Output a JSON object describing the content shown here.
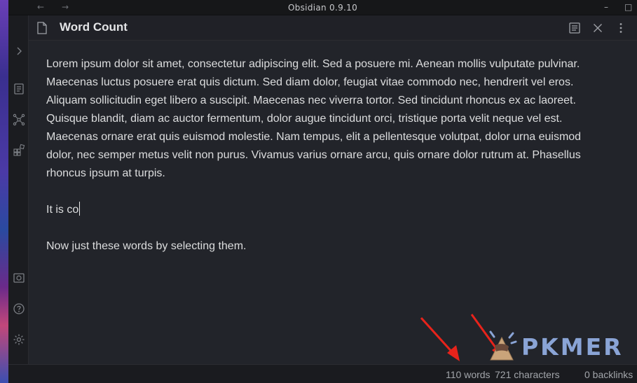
{
  "window": {
    "title": "Obsidian 0.9.10",
    "back_glyph": "←",
    "forward_glyph": "→",
    "minimize_glyph": "–",
    "maximize_glyph": "□"
  },
  "ribbon": {
    "icons": [
      "expand-chevron-icon",
      "switcher-icon",
      "graph-icon",
      "plugins-icon",
      "vault-icon",
      "help-icon",
      "settings-icon"
    ]
  },
  "pane": {
    "title": "Word Count",
    "actions": [
      "reading-view-icon",
      "close-icon",
      "more-options-icon"
    ]
  },
  "editor": {
    "paragraphs": [
      "Lorem ipsum dolor sit amet, consectetur adipiscing elit. Sed a posuere mi. Aenean mollis vulputate pulvinar. Maecenas luctus posuere erat quis dictum. Sed diam dolor, feugiat vitae commodo nec, hendrerit vel eros. Aliquam sollicitudin eget libero a suscipit. Maecenas nec viverra tortor. Sed tincidunt rhoncus ex ac laoreet. Quisque blandit, diam ac auctor fermentum, dolor augue tincidunt orci, tristique porta velit neque vel est. Maecenas ornare erat quis euismod molestie. Nam tempus, elit a pellentesque volutpat, dolor urna euismod dolor, nec semper metus velit non purus. Vivamus varius ornare arcu, quis ornare dolor rutrum at. Phasellus rhoncus ipsum at turpis.",
      "It is co",
      "Now just these words by selecting them."
    ]
  },
  "status": {
    "word_count": "110 words",
    "char_count": "721 characters",
    "backlinks": "0 backlinks"
  },
  "watermark": {
    "text": "PKMER"
  },
  "colors": {
    "annotation_arrow": "#e8231b",
    "editor_bg": "#22242a",
    "watermark": "#8aa4d6"
  }
}
